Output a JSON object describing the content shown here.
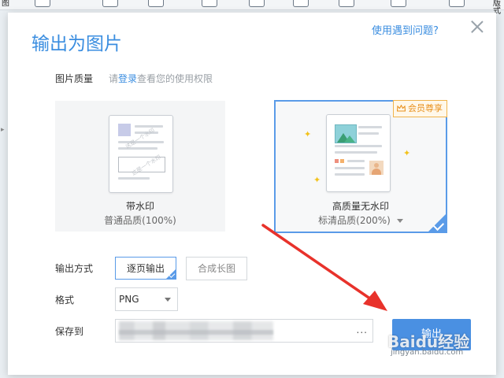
{
  "background_app": {
    "left_text": "图",
    "right_text": "版式"
  },
  "dialog": {
    "title": "输出为图片",
    "help_link": "使用遇到问题?",
    "quality": {
      "label": "图片质量",
      "hint_prefix": "请",
      "hint_link": "登录",
      "hint_suffix": "查看您的使用权限"
    },
    "cards": [
      {
        "title": "带水印",
        "subtitle": "普通品质(100%)",
        "watermark_text": "这是一个水印"
      },
      {
        "title": "高质量无水印",
        "subtitle": "标清品质(200%)",
        "badge": "会员尊享",
        "selected": true
      }
    ],
    "output_mode": {
      "label": "输出方式",
      "options": [
        "逐页输出",
        "合成长图"
      ],
      "selected": "逐页输出"
    },
    "format": {
      "label": "格式",
      "value": "PNG"
    },
    "save_to": {
      "label": "保存到",
      "browse": "..."
    },
    "output_button": "输出"
  },
  "watermark": {
    "logo": "Baidu经验",
    "url": "jingyan.baidu.com"
  },
  "colors": {
    "accent": "#4a90e2",
    "title_blue": "#3b8ee0",
    "vip_orange": "#e8901c",
    "annotation_red": "#e8322b"
  }
}
